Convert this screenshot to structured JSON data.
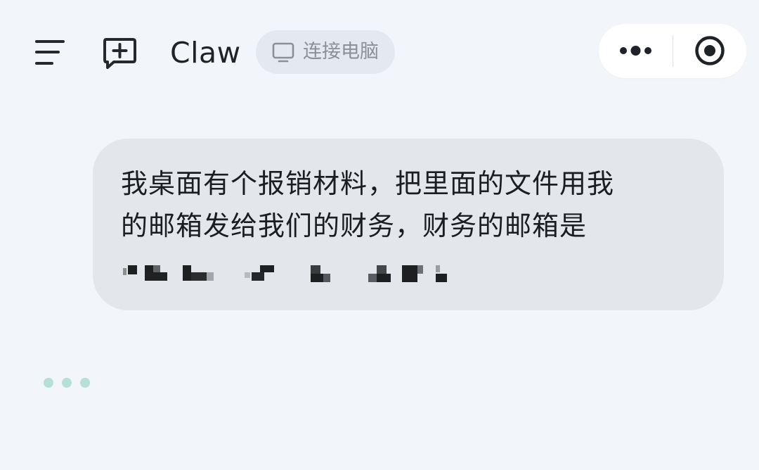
{
  "header": {
    "title": "Claw",
    "connect_label": "连接电脑"
  },
  "conversation": {
    "user_message": {
      "lines": [
        "我桌面有个报销材料，把里面的文件用我",
        "的邮箱发给我们的财务，财务的邮箱是"
      ],
      "email_redacted": true
    },
    "assistant_typing": true
  },
  "colors": {
    "background": "#f2f6fa",
    "user_bubble": "#e3e6ea",
    "connect_pill": "#e4e9ef",
    "capsule": "#ffffff",
    "typing_dots": "#b6dfd6",
    "icon": "#25282c"
  },
  "icons": {
    "menu": "menu-icon",
    "new_chat": "new-chat-icon",
    "monitor": "monitor-icon",
    "more": "more-icon",
    "close_target": "target-icon"
  }
}
